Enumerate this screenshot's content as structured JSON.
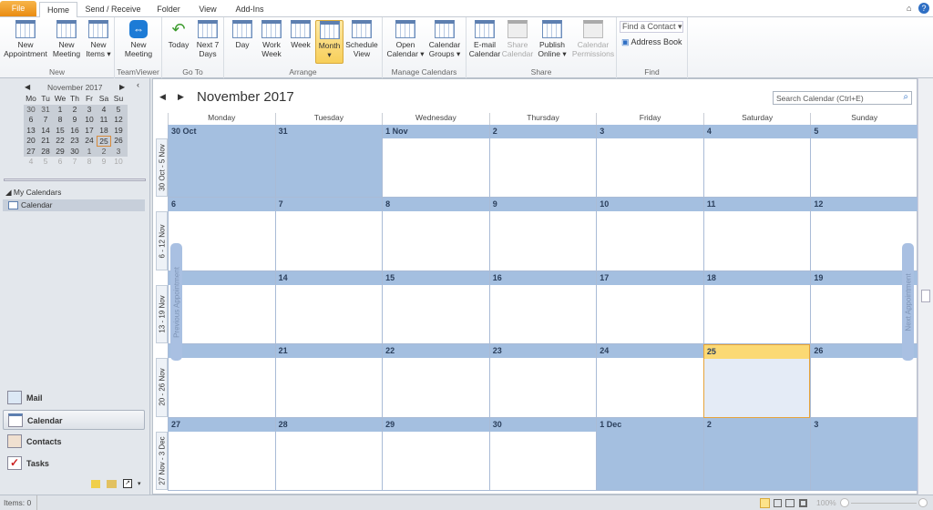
{
  "ribbon_tabs": [
    "File",
    "Home",
    "Send / Receive",
    "Folder",
    "View",
    "Add-Ins"
  ],
  "groups": {
    "new": {
      "label": "New",
      "buttons": [
        "New Appointment",
        "New Meeting",
        "New Items ▾"
      ]
    },
    "teamviewer": {
      "label": "TeamViewer",
      "buttons": [
        "New Meeting"
      ]
    },
    "goto": {
      "label": "Go To",
      "buttons": [
        "Today",
        "Next 7 Days"
      ]
    },
    "arrange": {
      "label": "Arrange",
      "buttons": [
        "Day",
        "Work Week",
        "Week",
        "Month ▾",
        "Schedule View"
      ],
      "selected": "Month"
    },
    "manage": {
      "label": "Manage Calendars",
      "buttons": [
        "Open Calendar ▾",
        "Calendar Groups ▾"
      ]
    },
    "share": {
      "label": "Share",
      "buttons": [
        "E-mail Calendar",
        "Share Calendar",
        "Publish Online ▾",
        "Calendar Permissions"
      ]
    },
    "find": {
      "label": "Find",
      "find_contact": "Find a Contact",
      "address_book": "Address Book"
    }
  },
  "mini_calendar": {
    "title": "November 2017",
    "dow": [
      "Mo",
      "Tu",
      "We",
      "Th",
      "Fr",
      "Sa",
      "Su"
    ],
    "weeks": [
      [
        "30",
        "31",
        "1",
        "2",
        "3",
        "4",
        "5"
      ],
      [
        "6",
        "7",
        "8",
        "9",
        "10",
        "11",
        "12"
      ],
      [
        "13",
        "14",
        "15",
        "16",
        "17",
        "18",
        "19"
      ],
      [
        "20",
        "21",
        "22",
        "23",
        "24",
        "25",
        "26"
      ],
      [
        "27",
        "28",
        "29",
        "30",
        "1",
        "2",
        "3"
      ],
      [
        "4",
        "5",
        "6",
        "7",
        "8",
        "9",
        "10"
      ]
    ],
    "today": "25"
  },
  "folders": {
    "header": "My Calendars",
    "items": [
      "Calendar"
    ]
  },
  "nav": [
    "Mail",
    "Calendar",
    "Contacts",
    "Tasks"
  ],
  "calendar": {
    "title": "November 2017",
    "search_placeholder": "Search Calendar (Ctrl+E)",
    "dow": [
      "Monday",
      "Tuesday",
      "Wednesday",
      "Thursday",
      "Friday",
      "Saturday",
      "Sunday"
    ],
    "weeks": [
      {
        "label": "30 Oct - 5 Nov",
        "days": [
          "30 Oct",
          "31",
          "1 Nov",
          "2",
          "3",
          "4",
          "5"
        ]
      },
      {
        "label": "6 - 12 Nov",
        "days": [
          "6",
          "7",
          "8",
          "9",
          "10",
          "11",
          "12"
        ]
      },
      {
        "label": "13 - 19 Nov",
        "days": [
          "13",
          "14",
          "15",
          "16",
          "17",
          "18",
          "19"
        ]
      },
      {
        "label": "20 - 26 Nov",
        "days": [
          "20",
          "21",
          "22",
          "23",
          "24",
          "25",
          "26"
        ]
      },
      {
        "label": "27 Nov - 3 Dec",
        "days": [
          "27",
          "28",
          "29",
          "30",
          "1 Dec",
          "2",
          "3"
        ]
      }
    ],
    "out_of_month": [
      "0-0",
      "0-1",
      "4-4",
      "4-5",
      "4-6"
    ],
    "today": "3-5",
    "previous_appointment": "Previous Appointment",
    "next_appointment": "Next Appointment"
  },
  "status": {
    "items": "Items: 0",
    "zoom": "100%"
  },
  "colors": {
    "out_of_month": "#a4bfe0",
    "today_header": "#fbd974",
    "accent": "#e98c12"
  }
}
